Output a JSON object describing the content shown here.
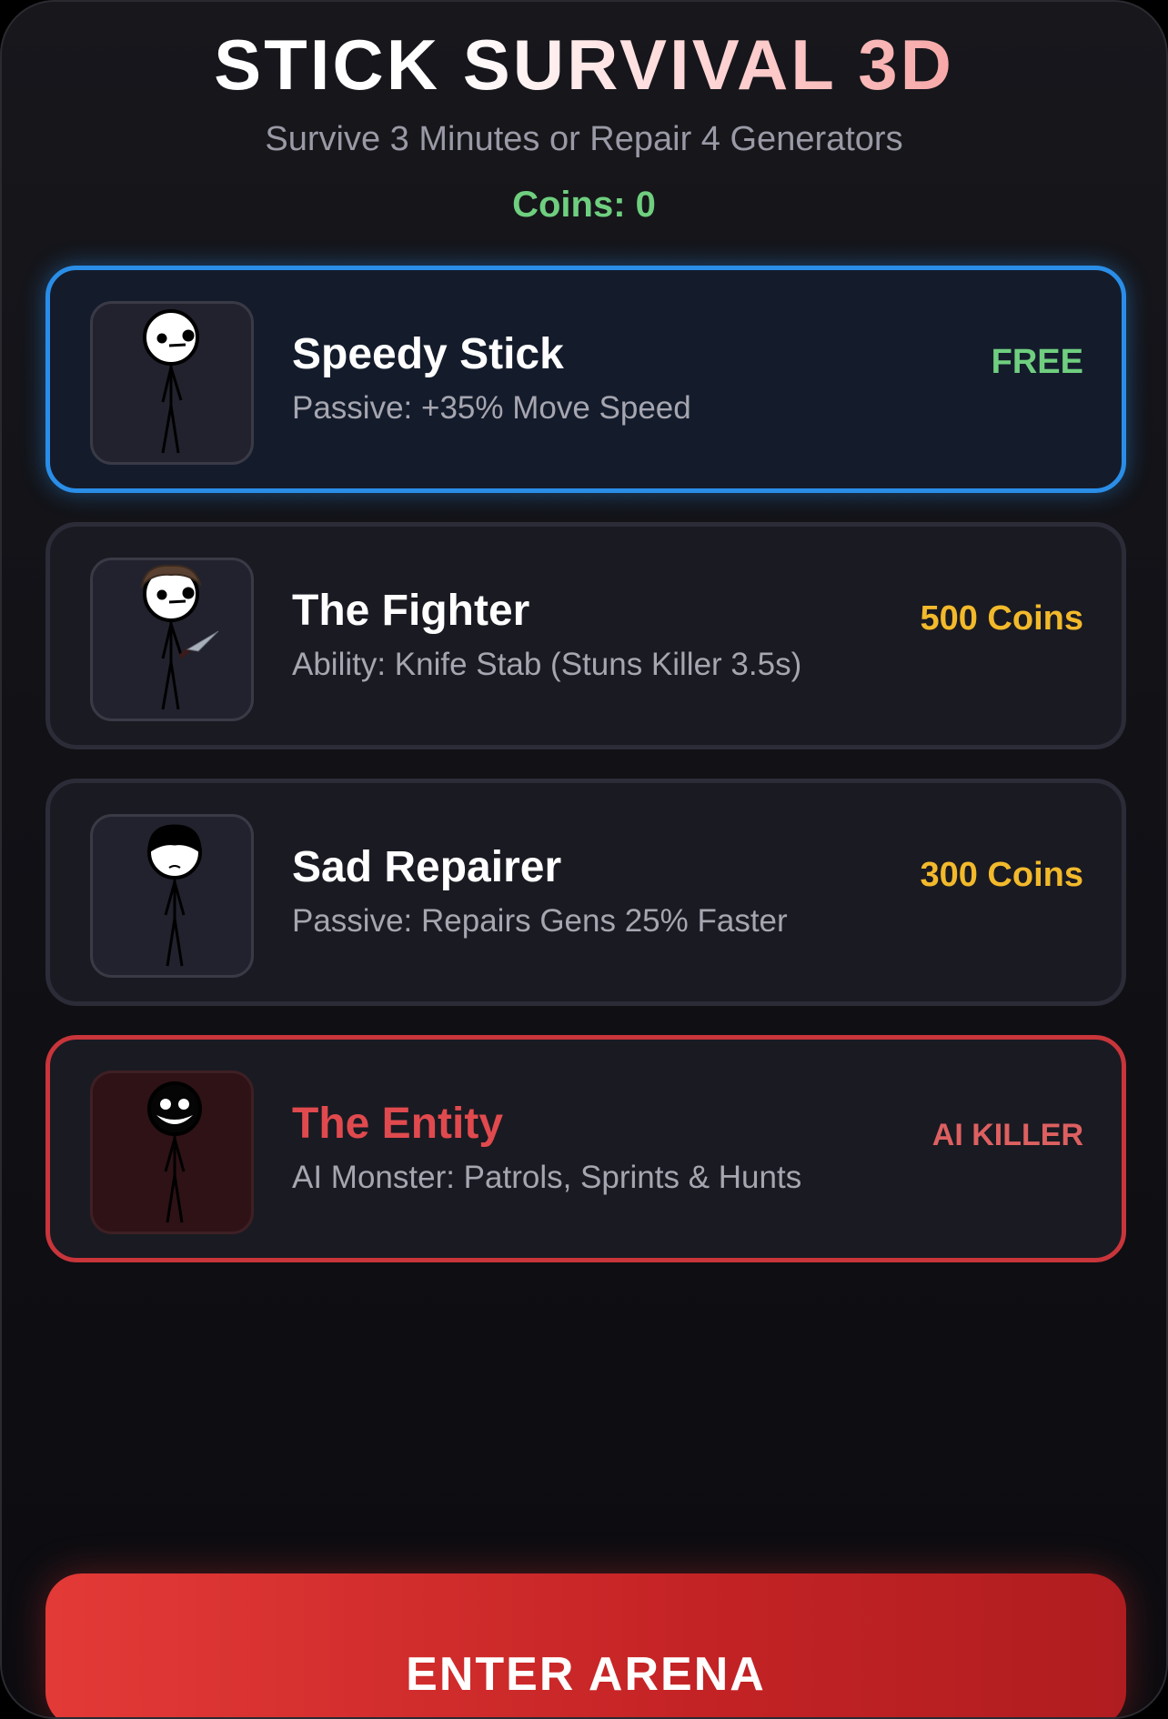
{
  "header": {
    "title": "STICK SURVIVAL 3D",
    "subtitle": "Survive 3 Minutes or Repair 4 Generators",
    "coins": "Coins: 0"
  },
  "characters": [
    {
      "name": "Speedy Stick",
      "description": "Passive: +35% Move Speed",
      "price": "FREE",
      "selected": true,
      "icon": "speedy-stick-figure-icon"
    },
    {
      "name": "The Fighter",
      "description": "Ability: Knife Stab (Stuns Killer 3.5s)",
      "price": "500 Coins",
      "selected": false,
      "icon": "fighter-stick-figure-with-knife-icon"
    },
    {
      "name": "Sad Repairer",
      "description": "Passive: Repairs Gens 25% Faster",
      "price": "300 Coins",
      "selected": false,
      "icon": "sad-repairer-stick-figure-icon"
    },
    {
      "name": "The Entity",
      "description": "AI Monster: Patrols, Sprints & Hunts",
      "price": "AI KILLER",
      "selected": false,
      "icon": "entity-monster-stick-figure-icon"
    }
  ],
  "actions": {
    "enter_label": "ENTER ARENA"
  },
  "colors": {
    "selected_border": "#2a8ee8",
    "killer_border": "#c8353a",
    "free": "#6fcf7f",
    "coin_price": "#f2b92b",
    "enter_button": "#d42e2e"
  }
}
